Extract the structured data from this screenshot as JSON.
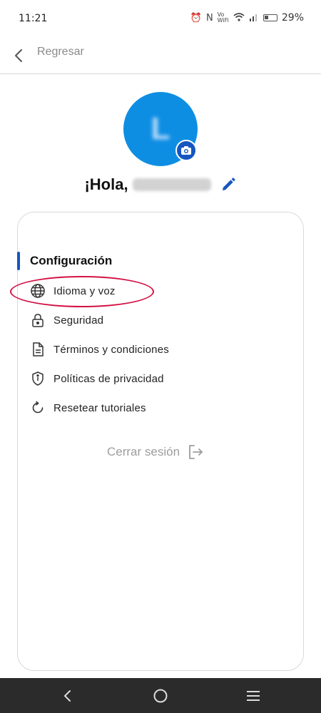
{
  "status_bar": {
    "time": "11:21",
    "battery": "29%"
  },
  "header": {
    "back_label": "Regresar"
  },
  "profile": {
    "avatar_initial": "L",
    "greeting": "¡Hola,"
  },
  "settings": {
    "section_title": "Configuración",
    "items": [
      {
        "label": "Idioma y voz",
        "icon": "globe-icon"
      },
      {
        "label": "Seguridad",
        "icon": "lock-icon"
      },
      {
        "label": "Términos y condiciones",
        "icon": "document-icon"
      },
      {
        "label": "Políticas de privacidad",
        "icon": "shield-icon"
      },
      {
        "label": "Resetear tutoriales",
        "icon": "refresh-icon"
      }
    ],
    "logout_label": "Cerrar sesión"
  },
  "colors": {
    "accent": "#1556c0",
    "avatar": "#0e8ee3",
    "highlight": "#d31145",
    "nav_bar": "#2b2b2b"
  }
}
